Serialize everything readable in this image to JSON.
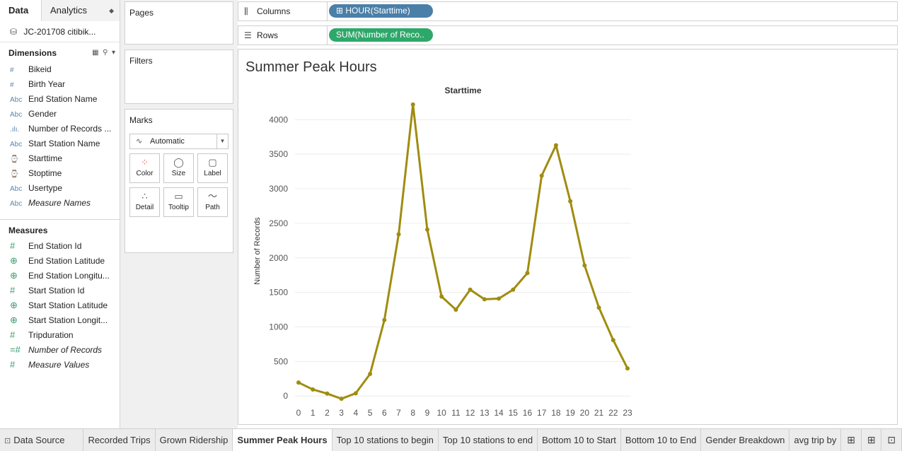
{
  "left_pane": {
    "tabs": {
      "data": "Data",
      "analytics": "Analytics"
    },
    "datasource": "JC-201708 citibik...",
    "dimensions_header": "Dimensions",
    "dimensions": [
      {
        "icon": "#",
        "label": "Bikeid",
        "italic": false
      },
      {
        "icon": "#",
        "label": "Birth Year",
        "italic": false
      },
      {
        "icon": "Abc",
        "label": "End Station Name",
        "italic": false
      },
      {
        "icon": "Abc",
        "label": "Gender",
        "italic": false
      },
      {
        "icon": ".ılı.",
        "label": "Number of Records ...",
        "italic": false
      },
      {
        "icon": "Abc",
        "label": "Start Station Name",
        "italic": false
      },
      {
        "icon": "⌚",
        "label": "Starttime",
        "italic": false
      },
      {
        "icon": "⌚",
        "label": "Stoptime",
        "italic": false
      },
      {
        "icon": "Abc",
        "label": "Usertype",
        "italic": false
      },
      {
        "icon": "Abc",
        "label": "Measure Names",
        "italic": true
      }
    ],
    "measures_header": "Measures",
    "measures": [
      {
        "icon": "#",
        "label": "End Station Id",
        "italic": false
      },
      {
        "icon": "⊕",
        "label": "End Station Latitude",
        "italic": false
      },
      {
        "icon": "⊕",
        "label": "End Station Longitu...",
        "italic": false
      },
      {
        "icon": "#",
        "label": "Start Station Id",
        "italic": false
      },
      {
        "icon": "⊕",
        "label": "Start Station Latitude",
        "italic": false
      },
      {
        "icon": "⊕",
        "label": "Start Station Longit...",
        "italic": false
      },
      {
        "icon": "#",
        "label": "Tripduration",
        "italic": false
      },
      {
        "icon": "=#",
        "label": "Number of Records",
        "italic": true
      },
      {
        "icon": "#",
        "label": "Measure Values",
        "italic": true
      }
    ]
  },
  "cards": {
    "pages": "Pages",
    "filters": "Filters",
    "marks": "Marks",
    "mark_type": "Automatic",
    "mark_buttons": {
      "color": "Color",
      "size": "Size",
      "label": "Label",
      "detail": "Detail",
      "tooltip": "Tooltip",
      "path": "Path"
    }
  },
  "shelves": {
    "columns_label": "Columns",
    "columns_pill": "⊞ HOUR(Starttime)",
    "rows_label": "Rows",
    "rows_pill": "SUM(Number of Reco.."
  },
  "viz": {
    "title": "Summer Peak Hours"
  },
  "chart_data": {
    "type": "line",
    "title": "Starttime",
    "xlabel": "",
    "ylabel": "Number of Records",
    "x": [
      0,
      1,
      2,
      3,
      4,
      5,
      6,
      7,
      8,
      9,
      10,
      11,
      12,
      13,
      14,
      15,
      16,
      17,
      18,
      19,
      20,
      21,
      22,
      23
    ],
    "series": [
      {
        "values": [
          195,
          95,
          35,
          -40,
          40,
          320,
          1100,
          2340,
          4220,
          2410,
          1440,
          1250,
          1540,
          1400,
          1410,
          1540,
          1780,
          3190,
          3630,
          2820,
          1890,
          1280,
          810,
          400
        ]
      }
    ],
    "yticks": [
      0,
      500,
      1000,
      1500,
      2000,
      2500,
      3000,
      3500,
      4000
    ],
    "ylim": [
      -100,
      4300
    ],
    "line_color": "#a08c0f",
    "grid": true
  },
  "bottom_tabs": {
    "data_source": "Data Source",
    "sheets": [
      "Recorded Trips",
      "Grown Ridership",
      "Summer Peak Hours",
      "Top 10 stations to begin",
      "Top 10 stations to end",
      "Bottom 10 to Start",
      "Bottom 10 to End",
      "Gender Breakdown",
      "avg trip by"
    ],
    "active": "Summer Peak Hours"
  }
}
